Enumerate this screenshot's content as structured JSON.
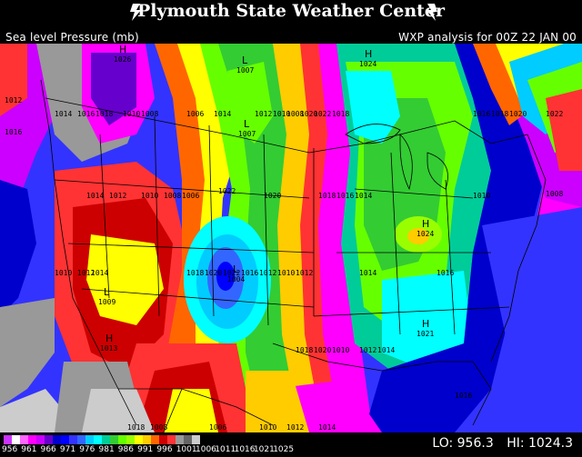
{
  "header": {
    "title": "Plymouth State Weather Center",
    "icon_left": "lightning-bolt-icon",
    "icon_right": "lightning-bolt-icon"
  },
  "subheader": {
    "field": "Sea level Pressure (mb)",
    "analysis": "WXP analysis for 00Z 22 JAN 00"
  },
  "legend": {
    "colors": [
      "#cc33ff",
      "#ffffff",
      "#ff66ff",
      "#ff00ff",
      "#cc00ff",
      "#6600cc",
      "#0000cc",
      "#0000ff",
      "#3333ff",
      "#3366ff",
      "#00ccff",
      "#00ffff",
      "#00cc99",
      "#33cc33",
      "#66ff00",
      "#99ff00",
      "#ffff00",
      "#ffcc00",
      "#ff6600",
      "#cc0000",
      "#ff3333",
      "#999999",
      "#666666",
      "#cccccc"
    ],
    "labels": [
      "956",
      "961",
      "966",
      "971",
      "976",
      "981",
      "986",
      "991",
      "996",
      "1001",
      "1006",
      "1011",
      "1016",
      "1021",
      "1025"
    ]
  },
  "stats": {
    "lo": "LO: 956.3",
    "hi": "HI: 1024.3"
  },
  "map": {
    "highs": [
      {
        "letter": "H",
        "value": "1026"
      },
      {
        "letter": "H",
        "value": "1024"
      },
      {
        "letter": "H",
        "value": "1024"
      },
      {
        "letter": "H",
        "value": "1021"
      },
      {
        "letter": "H",
        "value": "1013"
      }
    ],
    "lows": [
      {
        "letter": "L",
        "value": "1007"
      },
      {
        "letter": "L",
        "value": "1004"
      },
      {
        "letter": "L",
        "value": "1009"
      },
      {
        "letter": "L",
        "value": "1007"
      }
    ],
    "isobar_labels": [
      "1012",
      "1014",
      "1016",
      "1018",
      "1010",
      "1008",
      "1006",
      "1014",
      "1012",
      "1010",
      "1008",
      "1020",
      "1022",
      "1018",
      "1016",
      "1014",
      "1012",
      "1010",
      "1008",
      "1006",
      "1022",
      "1020",
      "1018",
      "1016",
      "1014",
      "1010",
      "1008",
      "1010",
      "1012",
      "1014",
      "1018",
      "1020",
      "1022",
      "1016",
      "1012",
      "1010",
      "1012",
      "1014",
      "1016",
      "1018",
      "1020",
      "1010",
      "1012",
      "1014",
      "1016",
      "1018",
      "1008",
      "1006",
      "1010",
      "1012",
      "1014",
      "1016",
      "1018",
      "1020",
      "1022"
    ]
  }
}
